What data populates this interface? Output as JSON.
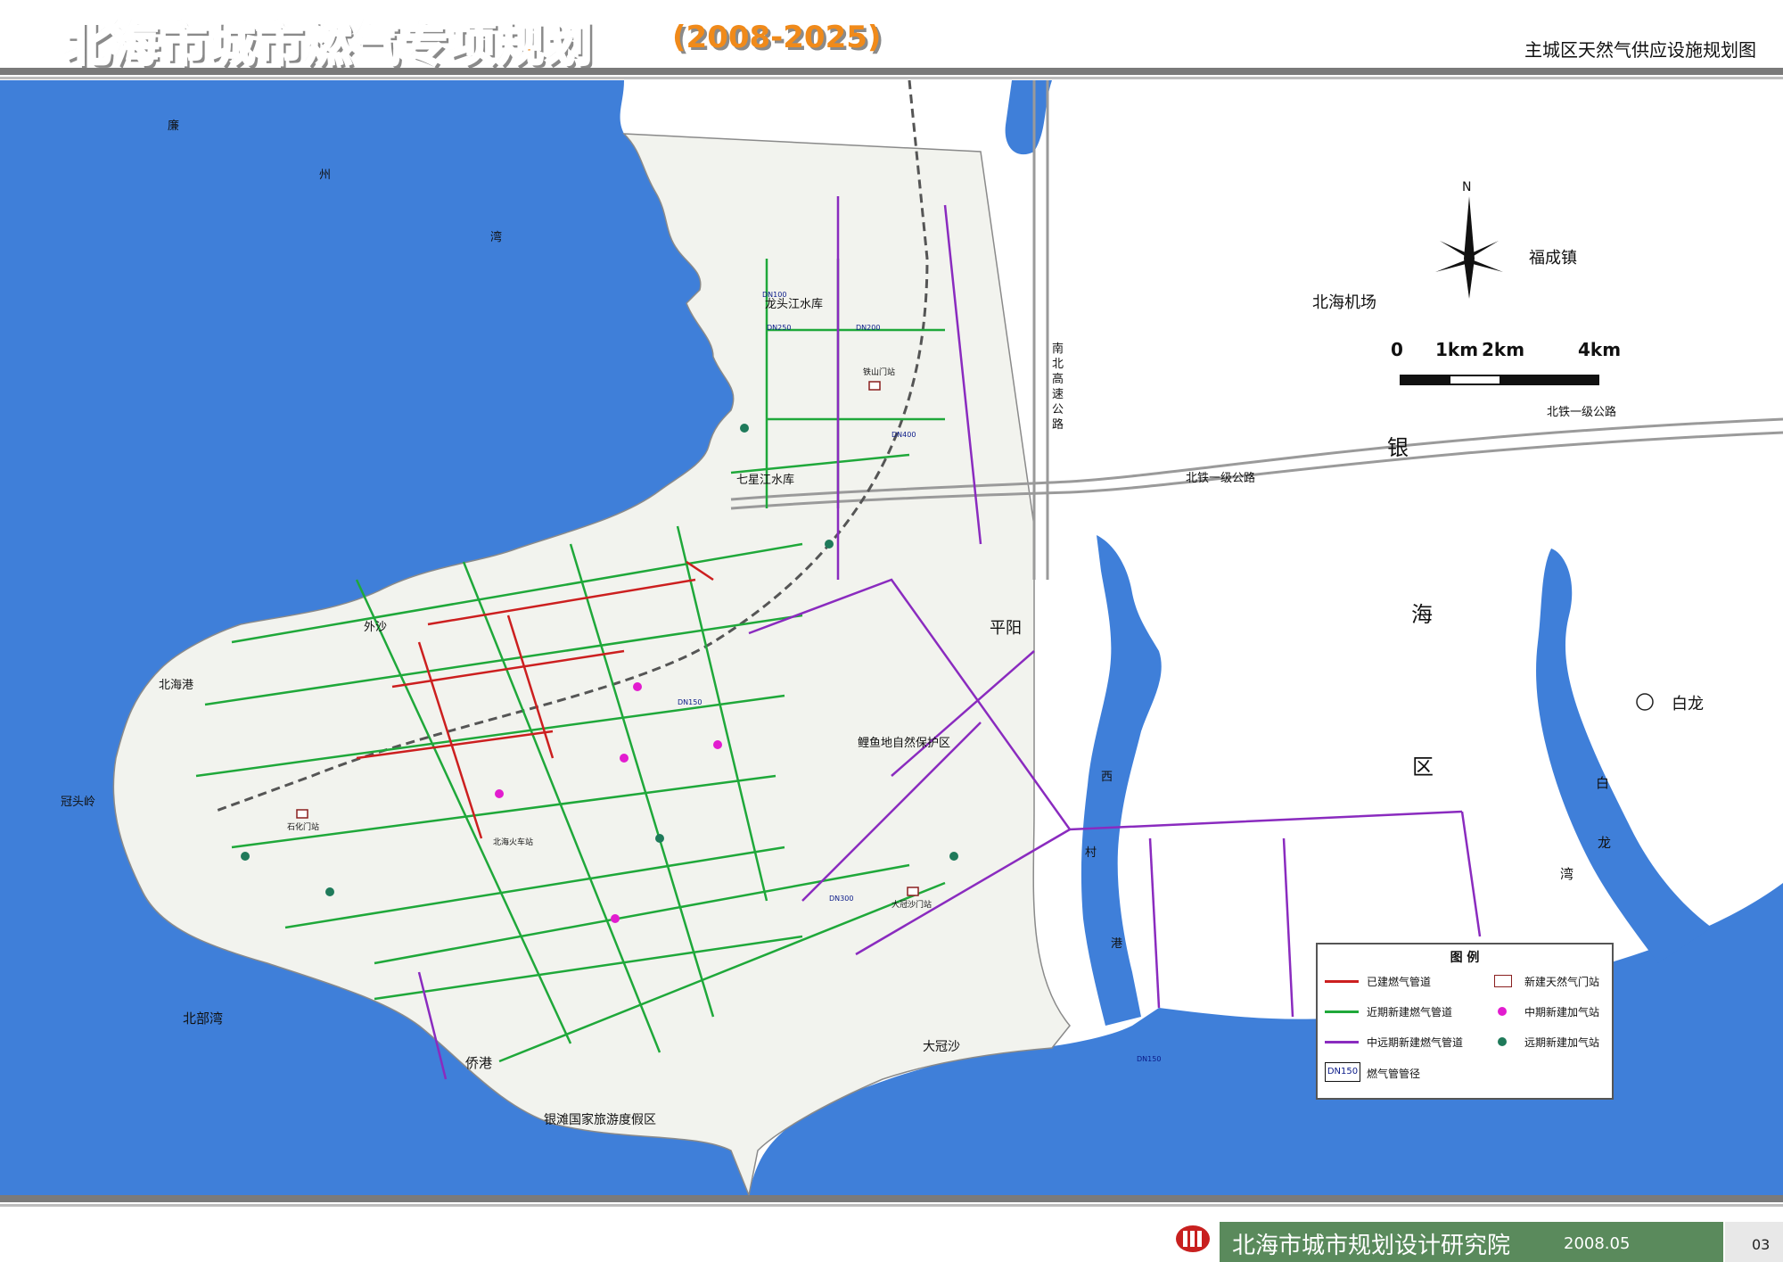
{
  "header": {
    "title_part1": "北海市城市",
    "title_part2": "燃气专项规划",
    "title_years": "(2008-2025)",
    "subtitle": "主城区天然气供应设施规划图"
  },
  "map": {
    "places": {
      "lianzhou_1": "廉",
      "lianzhou_2": "州",
      "lianzhou_3": "湾",
      "waisha": "外沙",
      "beihai_port": "北海港",
      "guantouling": "冠头岭",
      "beibu_gulf": "北部湾",
      "qiaogang": "侨港",
      "silver_beach": "银滩国家旅游度假区",
      "longtoujiang_reservoir": "龙头江水库",
      "qiluojiang_reservoir": "七星江水库",
      "fish_reserve": "鲤鱼地自然保护区",
      "pingyang": "平阳",
      "dagaosha": "大冠沙",
      "airport": "北海机场",
      "fucheng": "福成镇",
      "bailong": "白龙",
      "yinhai_1": "银",
      "yinhai_2": "海",
      "yinhai_3": "区",
      "xicun_1": "西",
      "xicun_2": "村",
      "xicun_3": "港",
      "bailongwan_1": "白",
      "bailongwan_2": "龙",
      "bailongwan_3": "湾",
      "highway_1": "南",
      "highway_2": "北",
      "highway_3": "高",
      "highway_4": "速",
      "highway_5": "公",
      "highway_6": "路",
      "beitie_road_1": "北铁一级公路",
      "beitie_road_2": "北铁一级公路",
      "station_north": "北海火车站",
      "gate_station_1": "石化门站",
      "gate_station_2": "大冠沙门站",
      "gate_station_3": "铁山门站"
    },
    "north_label": "N",
    "scale": {
      "t0": "0",
      "t1": "1km",
      "t2": "2km",
      "t4": "4km"
    },
    "pipe_labels": [
      "DN100",
      "DN150",
      "DN200",
      "DN250",
      "DN300",
      "DN400",
      "DN150"
    ],
    "colors": {
      "sea": "#3f7fd9",
      "land": "#f4f6f1",
      "built_pipe": "#cc1f1f",
      "near_pipe": "#1fa83a",
      "far_pipe": "#8a2bbf",
      "magenta_station": "#e21ccf",
      "green_station": "#1f7a5a"
    }
  },
  "legend": {
    "title": "图 例",
    "items": {
      "built": "已建燃气管道",
      "near": "近期新建燃气管道",
      "far": "中远期新建燃气管道",
      "diameter": "燃气管管径",
      "diameter_symbol": "DN150",
      "gate": "新建天然气门站",
      "mid_station": "中期新建加气站",
      "far_station": "远期新建加气站"
    }
  },
  "footer": {
    "org": "北海市城市规划设计研究院",
    "date": "2008.05",
    "page": "03"
  }
}
